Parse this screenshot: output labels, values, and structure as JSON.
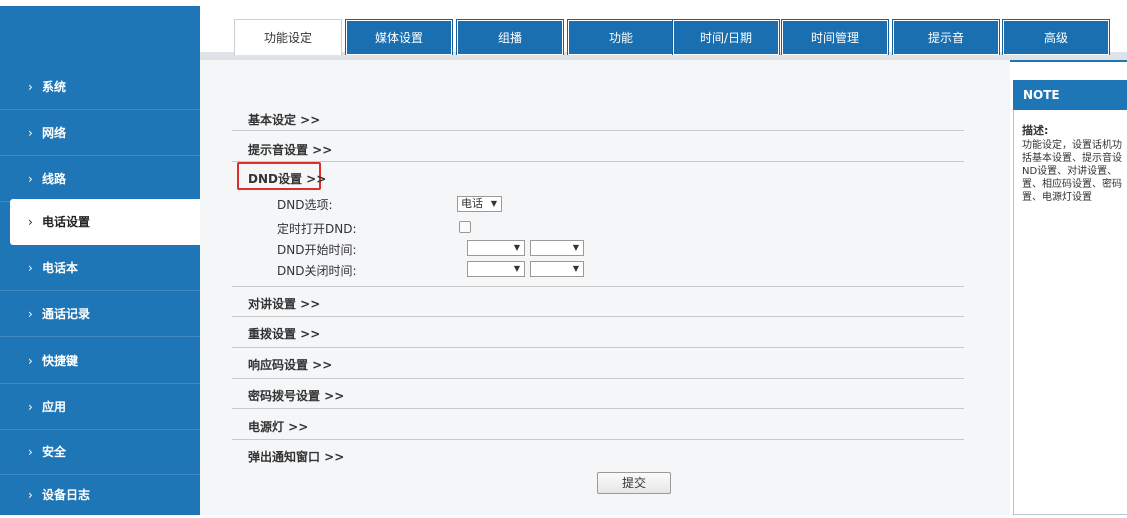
{
  "tabs": [
    {
      "label": "功能设定",
      "active": true
    },
    {
      "label": "媒体设置"
    },
    {
      "label": "组播"
    },
    {
      "label": "功能"
    },
    {
      "label": "时间/日期"
    },
    {
      "label": "时间管理"
    },
    {
      "label": "提示音"
    },
    {
      "label": "高级"
    }
  ],
  "sidebar": {
    "items": [
      {
        "label": "系统"
      },
      {
        "label": "网络"
      },
      {
        "label": "线路"
      },
      {
        "label": "电话设置",
        "active": true
      },
      {
        "label": "电话本"
      },
      {
        "label": "通话记录"
      },
      {
        "label": "快捷键"
      },
      {
        "label": "应用"
      },
      {
        "label": "安全"
      },
      {
        "label": "设备日志"
      }
    ],
    "chevron": "›"
  },
  "sections": {
    "basic": "基本设定 >>",
    "prompt_tone": "提示音设置 >>",
    "dnd": "DND设置 >>",
    "intercom": "对讲设置 >>",
    "redial": "重拨设置 >>",
    "response_code": "响应码设置 >>",
    "password_dial": "密码拨号设置 >>",
    "power_light": "电源灯 >>",
    "popup": "弹出通知窗口 >>"
  },
  "dnd": {
    "option_label": "DND选项:",
    "option_value": "电话",
    "timed_label": "定时打开DND:",
    "timed_checked": false,
    "start_label": "DND开始时间:",
    "end_label": "DND关闭时间:",
    "start_hour": "",
    "start_minute": "",
    "end_hour": "",
    "end_minute": ""
  },
  "submit_label": "提交",
  "note": {
    "title": "NOTE",
    "desc_label": "描述:",
    "lines": [
      "功能设定，设置话机功",
      "括基本设置、提示音设",
      "ND设置、对讲设置、",
      "置、相应码设置、密码",
      "置、电源灯设置"
    ]
  },
  "colors": {
    "brand_blue": "#1e76b7",
    "highlight_red": "#d9302c"
  },
  "icons": {
    "dropdown": "▼"
  }
}
